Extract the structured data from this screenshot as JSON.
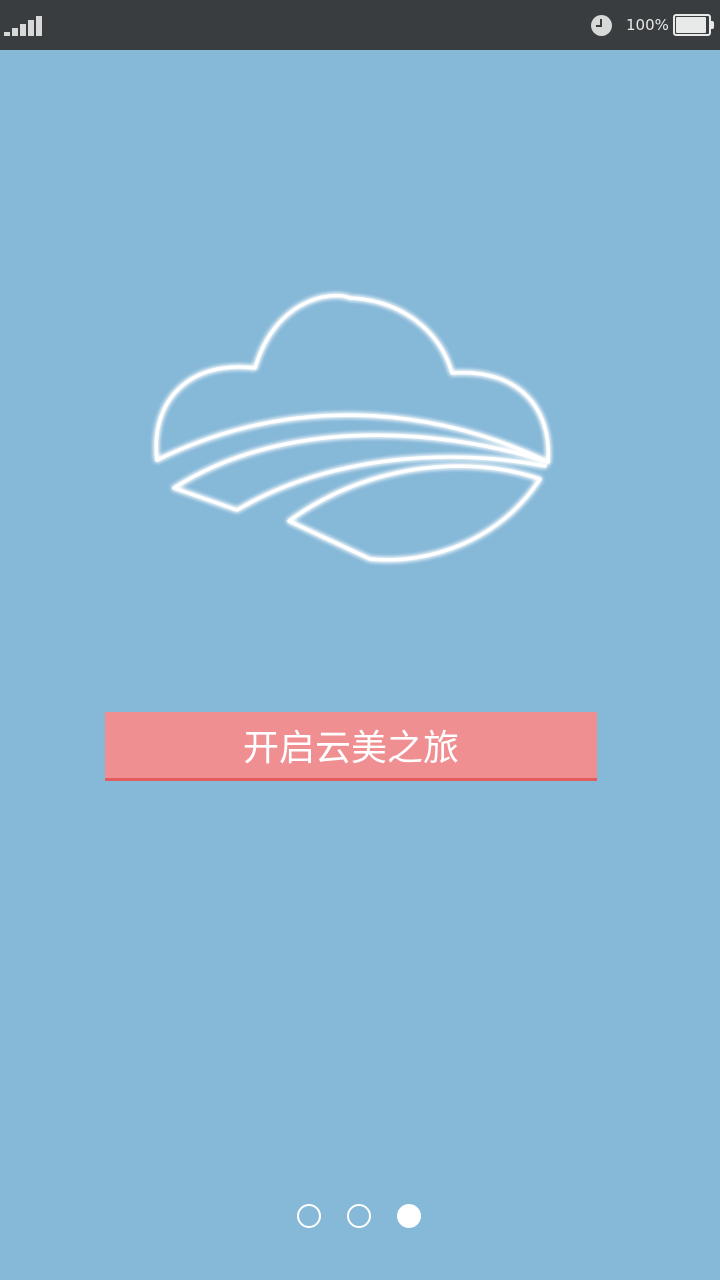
{
  "status_bar": {
    "battery_text": "100%",
    "icons": [
      "signal-icon",
      "clock-icon",
      "battery-icon"
    ],
    "signal_level": 5,
    "battery_level": 1.0
  },
  "main": {
    "logo_icon": "cloud-logo-icon",
    "start_button_label": "开启云美之旅"
  },
  "pager": {
    "page_count": 3,
    "active_page": 3
  },
  "colors": {
    "background": "#86b8d8",
    "status_bar": "#3a3d40",
    "button": "#f08f92",
    "button_border": "#e35d5f",
    "logo_stroke": "#ffffff"
  }
}
